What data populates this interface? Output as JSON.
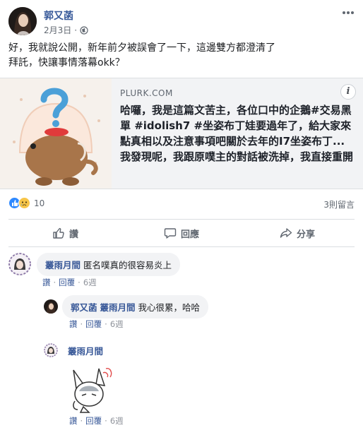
{
  "post": {
    "author": "郭又菡",
    "date": "2月3日",
    "text_line1": "好，我就說公開，新年前夕被誤會了一下，這邊雙方都澄清了",
    "text_line2": "拜託，快讓事情落幕okk？"
  },
  "link_card": {
    "domain": "PLURK.COM",
    "title": "哈囉，我是這篇文苦主，各位口中的企鵝#交易黑單 #idolish7 #坐姿布丁娃要過年了，給大家來點真相以及注意事項吧關於去年的I7坐姿布丁...我發現呢，我跟原噗主的對話被洗掉，我直接重開",
    "info_label": "i"
  },
  "reactions": {
    "count": "10",
    "comments_label": "3則留言"
  },
  "actions": {
    "like": "讚",
    "comment": "回應",
    "share": "分享"
  },
  "comments": [
    {
      "name": "叢雨月間",
      "text": "匿名噗真的很容易炎上",
      "like": "讚",
      "reply": "回覆",
      "time": "6週"
    },
    {
      "name": "郭又菡",
      "mention": "叢雨月間",
      "text": "我心很累，哈哈",
      "like": "讚",
      "reply": "回覆",
      "time": "6週"
    },
    {
      "name": "叢雨月間",
      "like": "讚",
      "reply": "回覆",
      "time": "6週"
    }
  ],
  "colors": {
    "link_blue": "#385898",
    "meta_gray": "#606770",
    "bubble_bg": "#f2f3f5",
    "like_blue": "#2e89ff",
    "sad_yellow": "#f7c548"
  }
}
